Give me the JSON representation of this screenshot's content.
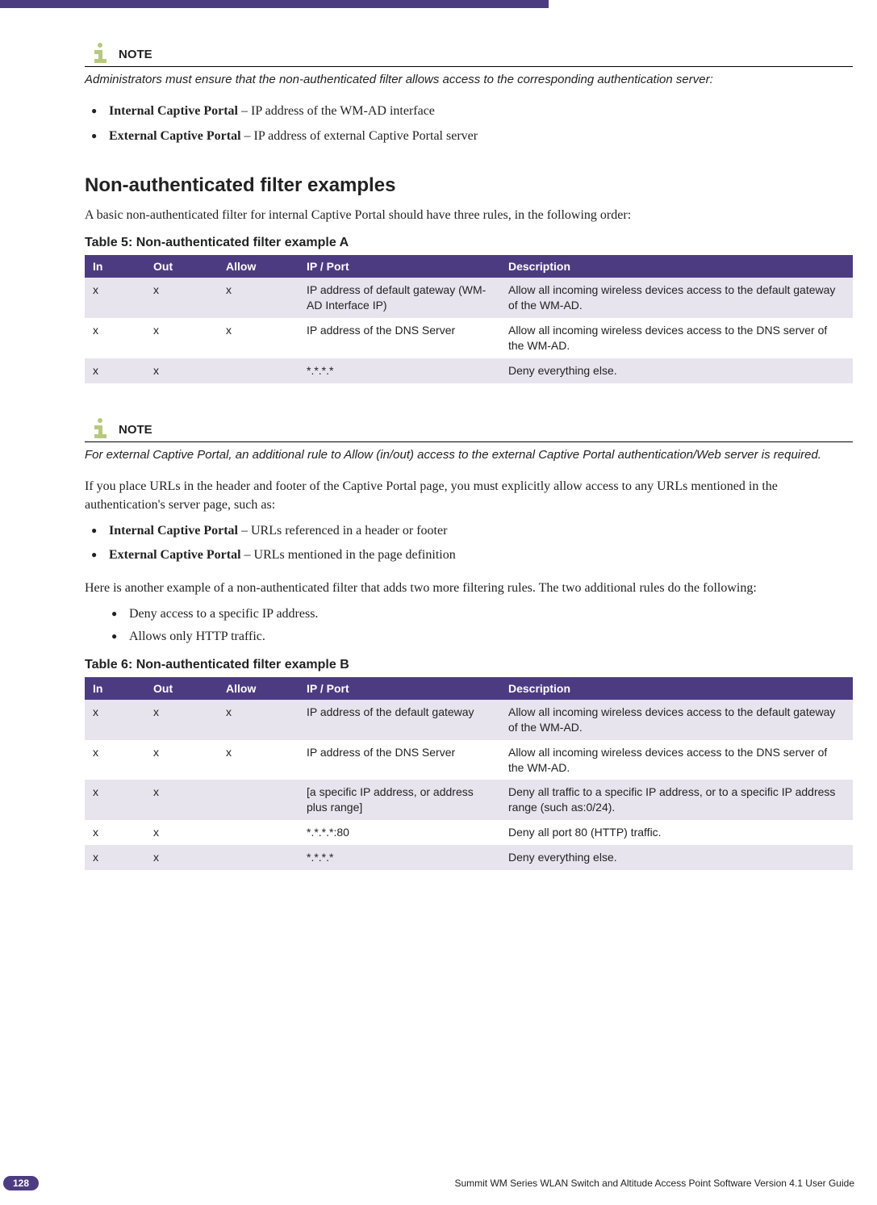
{
  "note1": {
    "label": "NOTE",
    "body": "Administrators must ensure that the non-authenticated filter allows access to the corresponding authentication server:"
  },
  "list1": [
    {
      "bold": "Internal Captive Portal",
      "rest": " – IP address of the WM-AD interface"
    },
    {
      "bold": "External Captive Portal",
      "rest": " – IP address of external Captive Portal server"
    }
  ],
  "section1": "Non-authenticated filter examples",
  "para1": "A basic non-authenticated filter for internal Captive Portal should have three rules, in the following order:",
  "table5": {
    "caption": "Table 5:  Non-authenticated filter example A",
    "headers": [
      "In",
      "Out",
      "Allow",
      "IP / Port",
      "Description"
    ],
    "rows": [
      {
        "in": "x",
        "out": "x",
        "allow": "x",
        "ip": "IP address of default gateway (WM-AD Interface IP)",
        "desc": "Allow all incoming wireless devices access to the default gateway of the WM-AD."
      },
      {
        "in": "x",
        "out": "x",
        "allow": "x",
        "ip": "IP address of the DNS Server",
        "desc": "Allow all incoming wireless devices access to the DNS server of the WM-AD."
      },
      {
        "in": "x",
        "out": "x",
        "allow": "",
        "ip": "*.*.*.*",
        "desc": "Deny everything else."
      }
    ]
  },
  "note2": {
    "label": "NOTE",
    "body": "For external Captive Portal, an additional rule to Allow (in/out) access to the external Captive Portal authentication/Web server is required."
  },
  "para2": "If you place URLs in the header and footer of the Captive Portal page, you must explicitly allow access to any URLs mentioned in the authentication's server page, such as:",
  "list2": [
    {
      "bold": "Internal Captive Portal",
      "rest": " – URLs referenced in a header or footer"
    },
    {
      "bold": "External Captive Portal",
      "rest": " – URLs mentioned in the page definition"
    }
  ],
  "para3": "Here is another example of a non-authenticated filter that adds two more filtering rules. The two additional rules do the following:",
  "list3": [
    "Deny access to a specific IP address.",
    "Allows only HTTP traffic."
  ],
  "table6": {
    "caption": "Table 6:  Non-authenticated filter example B",
    "headers": [
      "In",
      "Out",
      "Allow",
      "IP / Port",
      "Description"
    ],
    "rows": [
      {
        "in": "x",
        "out": "x",
        "allow": "x",
        "ip": "IP address of the default gateway",
        "desc": "Allow all incoming wireless devices access to the default gateway of the WM-AD."
      },
      {
        "in": "x",
        "out": "x",
        "allow": "x",
        "ip": "IP address of the DNS Server",
        "desc": "Allow all incoming wireless devices access to the DNS server of the WM-AD."
      },
      {
        "in": "x",
        "out": "x",
        "allow": "",
        "ip": "[a specific IP address, or address plus range]",
        "desc": "Deny all traffic to a specific IP address, or to a specific IP address range (such as:0/24)."
      },
      {
        "in": "x",
        "out": "x",
        "allow": "",
        "ip": "*.*.*.*:80",
        "desc": "Deny all port 80 (HTTP) traffic."
      },
      {
        "in": "x",
        "out": "x",
        "allow": "",
        "ip": "*.*.*.*",
        "desc": "Deny everything else."
      }
    ]
  },
  "footer": {
    "page": "128",
    "docTitle": "Summit WM Series WLAN Switch and Altitude Access Point Software Version 4.1 User Guide"
  }
}
